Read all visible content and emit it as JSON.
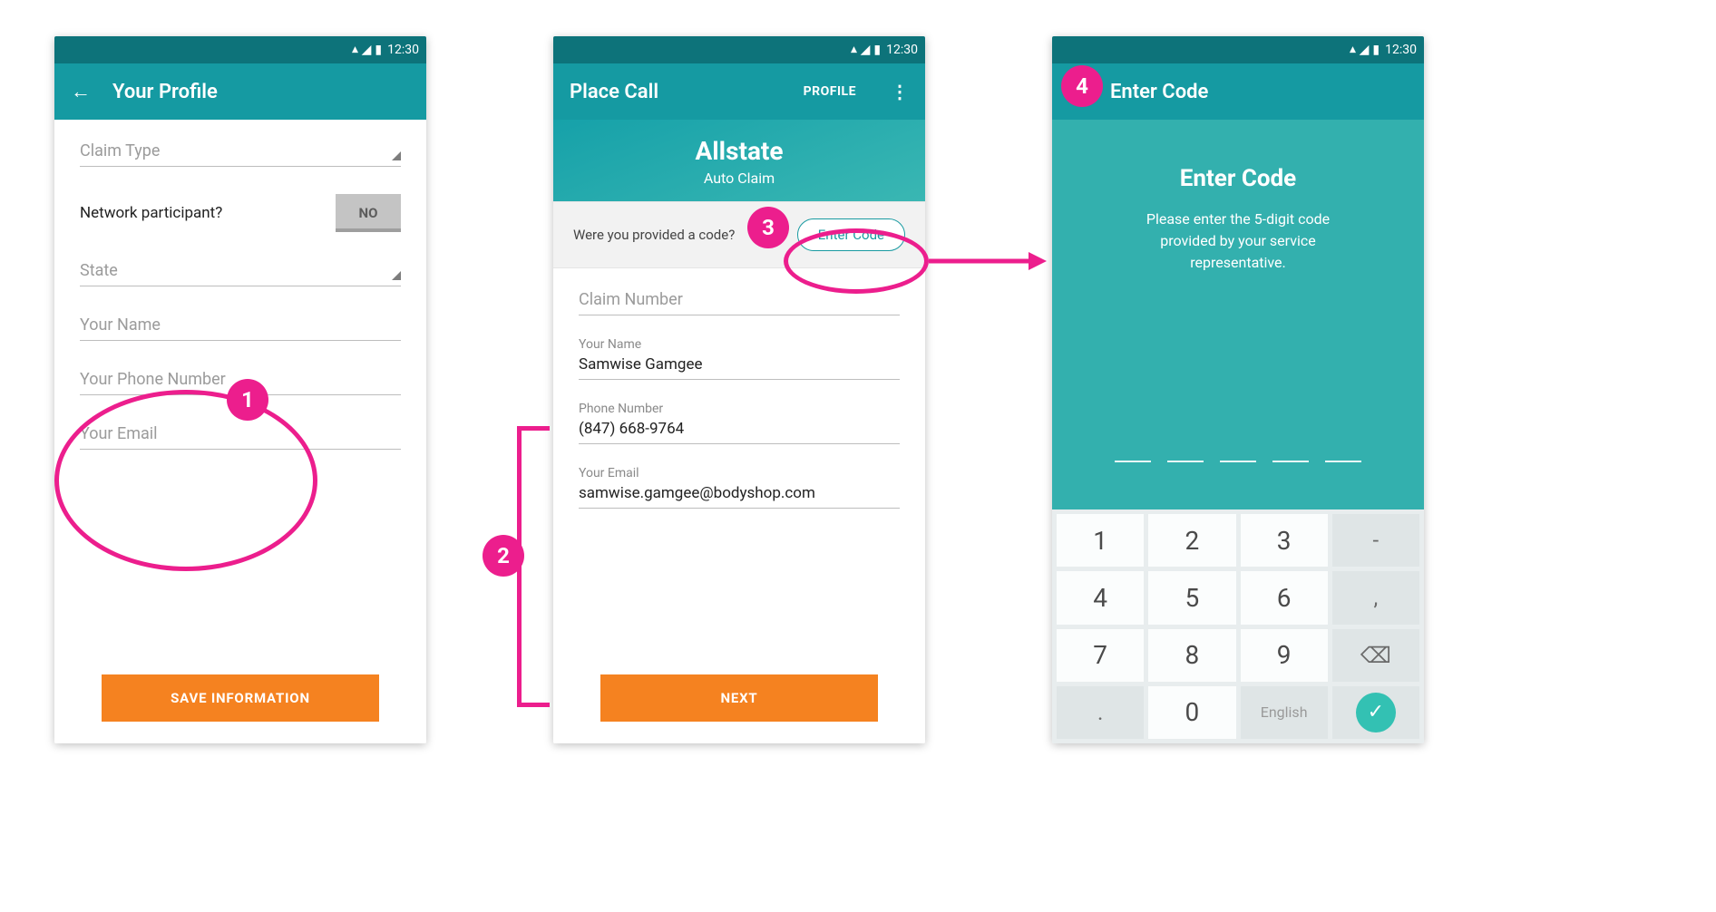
{
  "statusbar": {
    "time": "12:30",
    "icons": [
      "wifi",
      "signal",
      "battery"
    ]
  },
  "screen1": {
    "title": "Your Profile",
    "fields": {
      "claim_type_ph": "Claim Type",
      "network_question": "Network participant?",
      "toggle_value": "NO",
      "state_ph": "State",
      "name_ph": "Your Name",
      "phone_ph": "Your Phone Number",
      "email_ph": "Your Email"
    },
    "cta": "SAVE INFORMATION"
  },
  "screen2": {
    "title": "Place Call",
    "profile_btn": "PROFILE",
    "header": {
      "company": "Allstate",
      "subtitle": "Auto Claim"
    },
    "code_prompt": "Were you provided a code?",
    "enter_code_btn": "Enter Code",
    "fields": {
      "claim_number_ph": "Claim Number",
      "name_label": "Your Name",
      "name_value": "Samwise Gamgee",
      "phone_label": "Phone Number",
      "phone_value": "(847) 668-9764",
      "email_label": "Your Email",
      "email_value": "samwise.gamgee@bodyshop.com"
    },
    "cta": "NEXT"
  },
  "screen3": {
    "appbar_title": "Enter Code",
    "title": "Enter Code",
    "message": "Please enter the 5-digit code provided by your service representative.",
    "code_length": 5,
    "keypad": {
      "rows": [
        [
          "1",
          "2",
          "3",
          "-"
        ],
        [
          "4",
          "5",
          "6",
          ","
        ],
        [
          "7",
          "8",
          "9",
          "⌫"
        ],
        [
          ".",
          "0",
          "English",
          "✓"
        ]
      ]
    }
  },
  "annotations": {
    "1": "1",
    "2": "2",
    "3": "3",
    "4": "4"
  },
  "colors": {
    "teal_dark": "#0d737a",
    "teal": "#159aa2",
    "teal_light": "#33b0ae",
    "orange": "#f58220",
    "pink": "#ec1e8d"
  }
}
